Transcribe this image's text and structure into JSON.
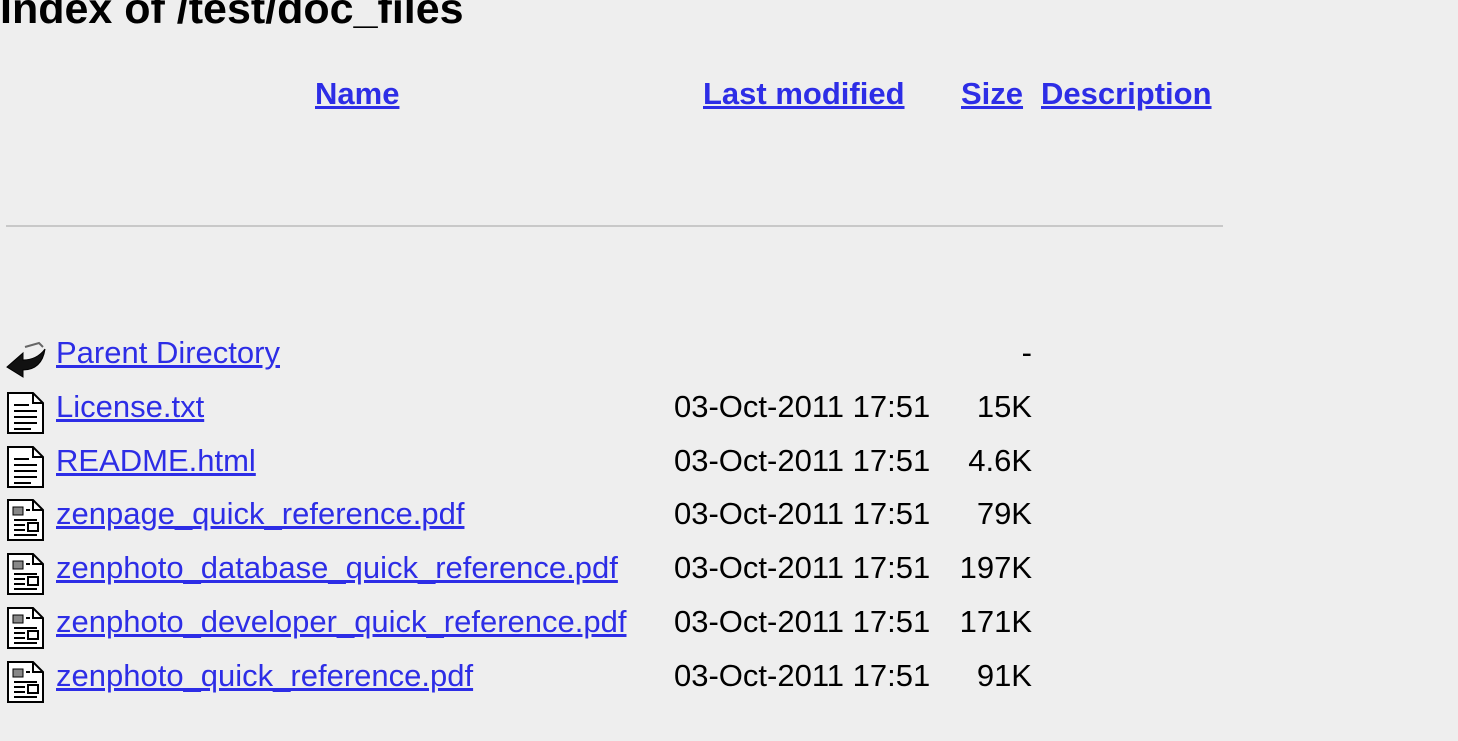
{
  "page": {
    "title": "Index of /test/doc_files"
  },
  "columns": {
    "name": "Name",
    "last_modified": "Last modified",
    "size": "Size",
    "description": "Description"
  },
  "entries": [
    {
      "name": "Parent Directory",
      "date": "",
      "size": "-",
      "icon": "back-icon"
    },
    {
      "name": "License.txt",
      "date": "03-Oct-2011 17:51",
      "size": "15K",
      "icon": "text-file-icon"
    },
    {
      "name": "README.html",
      "date": "03-Oct-2011 17:51",
      "size": "4.6K",
      "icon": "text-file-icon"
    },
    {
      "name": "zenpage_quick_reference.pdf",
      "date": "03-Oct-2011 17:51",
      "size": "79K",
      "icon": "layout-file-icon"
    },
    {
      "name": "zenphoto_database_quick_reference.pdf",
      "date": "03-Oct-2011 17:51",
      "size": "197K",
      "icon": "layout-file-icon"
    },
    {
      "name": "zenphoto_developer_quick_reference.pdf",
      "date": "03-Oct-2011 17:51",
      "size": "171K",
      "icon": "layout-file-icon"
    },
    {
      "name": "zenphoto_quick_reference.pdf",
      "date": "03-Oct-2011 17:51",
      "size": "91K",
      "icon": "layout-file-icon"
    }
  ]
}
